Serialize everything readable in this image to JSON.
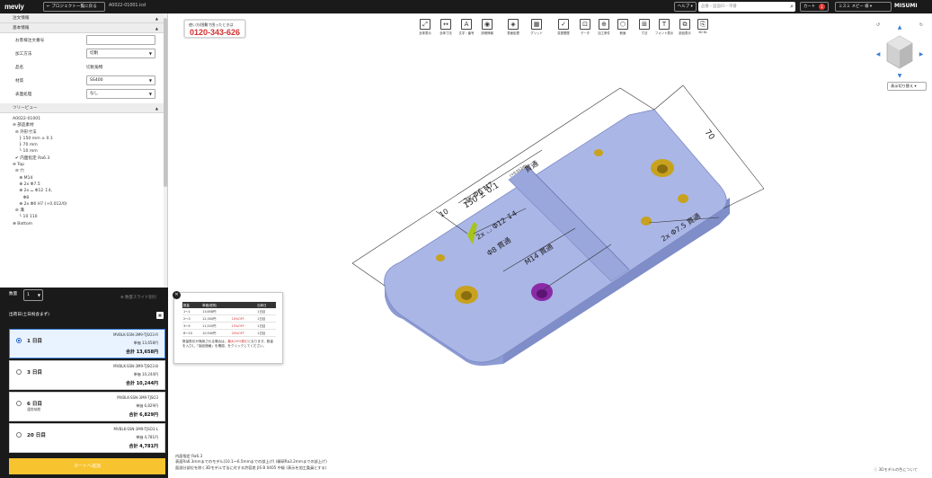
{
  "header": {
    "logo": "meviy",
    "back_label": "← プロジェクト一覧に戻る",
    "file_id": "A0022-01001.icd",
    "help_label": "ヘルプ ▾",
    "search_placeholder": "品番・図面ID・単番",
    "cart_label": "カート",
    "cart_count": "1",
    "account_label": "ミスミ メビー 様 ▾",
    "brand": "MISUMI"
  },
  "sidebar": {
    "sections": {
      "order_info": "注文情報",
      "basic_info": "基本情報",
      "tree_view": "ツリービュー"
    },
    "fields": [
      {
        "label": "お客様注文番号",
        "value": "",
        "type": "input"
      },
      {
        "label": "加工方法",
        "value": "切削",
        "type": "select"
      },
      {
        "label": "品名",
        "value": "切削角物",
        "type": "text"
      },
      {
        "label": "材質",
        "value": "SS400",
        "type": "select"
      },
      {
        "label": "表面処理",
        "value": "なし",
        "type": "select"
      }
    ],
    "tree": [
      "A0022-01001",
      "⊖ 部品素材",
      "  ⊖ 外形寸法",
      "     ├ 150 mm ± 0.1",
      "     ├ 70 mm",
      "     └ 10 mm",
      "  ✔ 内面指定 Ra6.3",
      "⊖ Top",
      "  ⊖ 穴",
      "     ⊕ M14",
      "     ⊕ 2x Φ7.5",
      "     ⊕ 2x ⌴ Φ12 ↧4,",
      "        Φ8",
      "     ⊕ 2x Φ6 H7 (+0.012/0)",
      "  ⊖ 溝",
      "     └ 10 110",
      "⊕ Bottom"
    ]
  },
  "order": {
    "qty_label": "数量",
    "qty_value": "1",
    "qty_link": "⊕ 数量スライド割引",
    "ship_label": "出荷日(土日祝含まず)",
    "options": [
      {
        "days": "1 日目",
        "sub": "",
        "code": "MVBLK-SSN-3M9-TJSO3-R",
        "unit": "単価 13,658円",
        "total": "合計 13,658円",
        "selected": true
      },
      {
        "days": "3 日目",
        "sub": "",
        "code": "MVBLK-SSN-3M9-TJSO3-B",
        "unit": "単価 10,244円",
        "total": "合計 10,244円",
        "selected": false
      },
      {
        "days": "6 日目",
        "sub": "通常納期",
        "code": "MVBLK-SSN-3M9-TJSO3",
        "unit": "単価 6,829円",
        "total": "合計 6,829円",
        "selected": false
      },
      {
        "days": "20 日目",
        "sub": "",
        "code": "MVBLK-SSN-3M9-TJSO3-L",
        "unit": "単価 4,781円",
        "total": "合計 4,781円",
        "selected": false
      }
    ],
    "cart_button": "カートへ追加"
  },
  "phone": {
    "caption": "使い方/困難で困ったときは",
    "number": "0120-343-626"
  },
  "toolbar": [
    {
      "label": "全体表示",
      "icon": "⤢"
    },
    {
      "label": "全体寸法",
      "icon": "↔"
    },
    {
      "label": "文字・番号",
      "icon": "A"
    },
    {
      "label": "詳細情報",
      "icon": "◉"
    },
    {
      "label": "表面処理",
      "icon": "◈"
    },
    {
      "label": "グリッド",
      "icon": "▦"
    },
    {
      "label": "変更履歴",
      "icon": "✓"
    },
    {
      "label": "データ",
      "icon": "⊡"
    },
    {
      "label": "加工条件",
      "icon": "⊕"
    },
    {
      "label": "断面",
      "icon": "⬡"
    },
    {
      "label": "寸法",
      "icon": "⊞"
    },
    {
      "label": "フォント表示",
      "icon": "T"
    },
    {
      "label": "部品表示",
      "icon": "⧉"
    },
    {
      "label": "3D DL",
      "icon": "⎘"
    }
  ],
  "viewer": {
    "view_select": "表示切り替え ▾",
    "dims": {
      "length": "150 ± 0.1",
      "width": "70",
      "thickness": "10",
      "hole_a": "2x Φ6 H7",
      "tol": "(+0.012/0)",
      "through": "貫通",
      "hole_b": "2x ⌴ Φ12 ↧4",
      "hole_b2": "Φ8 貫通",
      "hole_c": "M14 貫通",
      "hole_d": "2x Φ7.5 貫通"
    }
  },
  "popup": {
    "headers": [
      "数量",
      "単価(税別)",
      "",
      "出荷日"
    ],
    "rows": [
      [
        "1〜1",
        "13,658円",
        "",
        "1日目"
      ],
      [
        "2〜3",
        "12,300円",
        "10%OFF",
        "1日目"
      ],
      [
        "3〜5",
        "11,520円",
        "15%OFF",
        "1日目"
      ],
      [
        "6〜10",
        "10,940円",
        "20%OFF",
        "1日目"
      ]
    ],
    "note_a": "数量割引が適用される場合は、",
    "note_red": "最大20%割引",
    "note_b": "となります。数量を入力し「製品価格」を確認、をクリックしてください。"
  },
  "footer": {
    "line1": "内面指定 Ra6.3",
    "line2": "表面Ra6.3mmまでのモデル(10.1〜6.5mmまでの部上げ) (精研Ra3.2mmまでの部上げ)",
    "line3": "面部分部位を除く3Dモデル寸法に対する許容差 JIS B 0405 中級 (表示を加工委員とする)",
    "about": "ⓘ 3Dモデルの色について"
  },
  "colors": {
    "part": "#aab6e6",
    "part_side": "#8d9bd4",
    "csink": "#c8a21e",
    "tapped": "#8a2aa6",
    "slot_highlight": "#a7c41a"
  }
}
